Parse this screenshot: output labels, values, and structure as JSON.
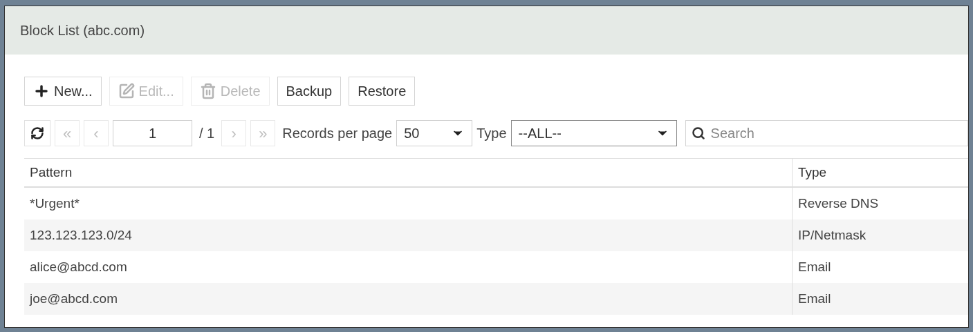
{
  "panel": {
    "title": "Block List (abc.com)"
  },
  "toolbar": [
    {
      "kind": "new",
      "label": "New...",
      "disabled": false
    },
    {
      "kind": "edit",
      "label": "Edit...",
      "disabled": true
    },
    {
      "kind": "delete",
      "label": "Delete",
      "disabled": true
    },
    {
      "kind": "plain",
      "label": "Backup",
      "disabled": false
    },
    {
      "kind": "plain",
      "label": "Restore",
      "disabled": false
    }
  ],
  "pager": {
    "page": "1",
    "total": "/ 1",
    "first": "«",
    "prev": "‹",
    "next": "›",
    "last": "»",
    "records_label": "Records per page",
    "records_value": "50",
    "type_label": "Type",
    "type_value": "--ALL--",
    "search_placeholder": "Search"
  },
  "table": {
    "columns": [
      "Pattern",
      "Type"
    ],
    "rows": [
      {
        "pattern": "*Urgent*",
        "type": "Reverse DNS"
      },
      {
        "pattern": "123.123.123.0/24",
        "type": "IP/Netmask"
      },
      {
        "pattern": "alice@abcd.com",
        "type": "Email"
      },
      {
        "pattern": "joe@abcd.com",
        "type": "Email"
      }
    ]
  }
}
